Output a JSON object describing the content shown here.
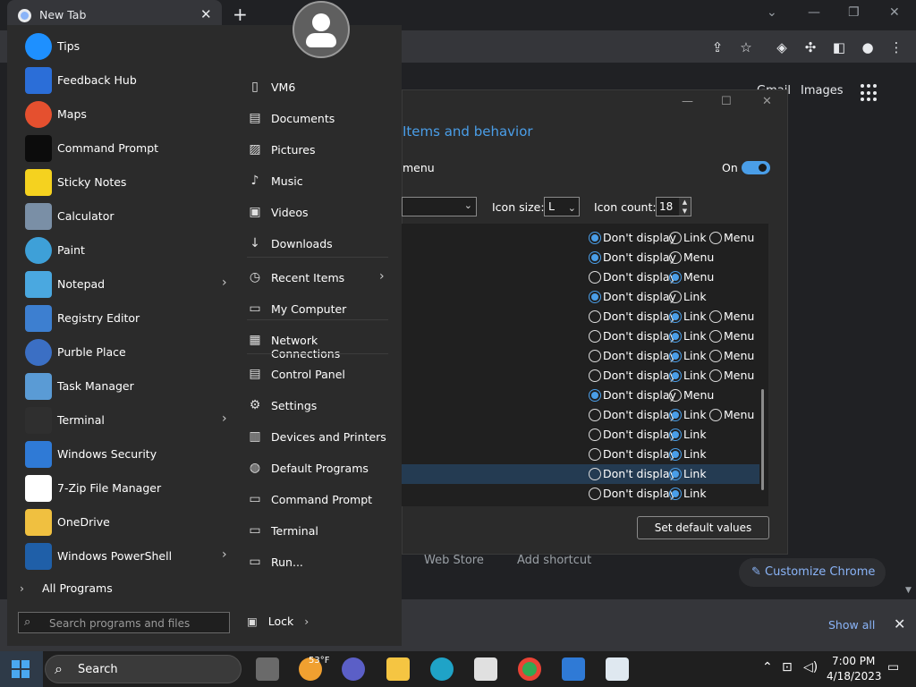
{
  "chrome": {
    "tab_title": "New Tab",
    "tab_close": "✕",
    "new_tab": "+",
    "gmail": "Gmail",
    "images": "Images",
    "shortcuts": [
      "Web Store",
      "Add shortcut"
    ],
    "customize": "Customize Chrome",
    "show_all": "Show all"
  },
  "dialog": {
    "title": "Items and behavior",
    "menu_label": "menu",
    "toggle_label": "On",
    "toggle_on": true,
    "icon_size_label": "Icon size:",
    "icon_size_value": "L",
    "icon_count_label": "Icon count:",
    "icon_count_value": "18",
    "default_button": "Set default values",
    "options_rows": [
      {
        "choices": [
          "Don't display",
          "Link",
          "Menu"
        ],
        "selected": 0,
        "highlight": false
      },
      {
        "choices": [
          "Don't display",
          "Menu"
        ],
        "selected": 0,
        "highlight": false
      },
      {
        "choices": [
          "Don't display",
          "Menu"
        ],
        "selected": 1,
        "highlight": false
      },
      {
        "choices": [
          "Don't display",
          "Link"
        ],
        "selected": 0,
        "highlight": false
      },
      {
        "choices": [
          "Don't display",
          "Link",
          "Menu"
        ],
        "selected": 1,
        "highlight": false
      },
      {
        "choices": [
          "Don't display",
          "Link",
          "Menu"
        ],
        "selected": 1,
        "highlight": false
      },
      {
        "choices": [
          "Don't display",
          "Link",
          "Menu"
        ],
        "selected": 1,
        "highlight": false
      },
      {
        "choices": [
          "Don't display",
          "Link",
          "Menu"
        ],
        "selected": 1,
        "highlight": false
      },
      {
        "choices": [
          "Don't display",
          "Menu"
        ],
        "selected": 0,
        "highlight": false
      },
      {
        "choices": [
          "Don't display",
          "Link",
          "Menu"
        ],
        "selected": 1,
        "highlight": false
      },
      {
        "choices": [
          "Don't display",
          "Link"
        ],
        "selected": 1,
        "highlight": false
      },
      {
        "choices": [
          "Don't display",
          "Link"
        ],
        "selected": 1,
        "highlight": false
      },
      {
        "choices": [
          "Don't display",
          "Link"
        ],
        "selected": 1,
        "highlight": true
      },
      {
        "choices": [
          "Don't display",
          "Link"
        ],
        "selected": 1,
        "highlight": false
      }
    ]
  },
  "start_menu": {
    "programs": [
      {
        "label": "Tips",
        "icon": "tips-icon",
        "color": "#1e90ff",
        "submenu": false
      },
      {
        "label": "Feedback Hub",
        "icon": "feedback-hub-icon",
        "color": "#2b6ed8",
        "submenu": false
      },
      {
        "label": "Maps",
        "icon": "maps-icon",
        "color": "#e5502f",
        "submenu": false
      },
      {
        "label": "Command Prompt",
        "icon": "command-prompt-icon",
        "color": "#0c0c0c",
        "submenu": false
      },
      {
        "label": "Sticky Notes",
        "icon": "sticky-notes-icon",
        "color": "#f5d21f",
        "submenu": false
      },
      {
        "label": "Calculator",
        "icon": "calculator-icon",
        "color": "#7a8fa6",
        "submenu": false
      },
      {
        "label": "Paint",
        "icon": "paint-icon",
        "color": "#3ea0d8",
        "submenu": false
      },
      {
        "label": "Notepad",
        "icon": "notepad-icon",
        "color": "#4aa8e0",
        "submenu": true
      },
      {
        "label": "Registry Editor",
        "icon": "registry-editor-icon",
        "color": "#3d7fd0",
        "submenu": false
      },
      {
        "label": "Purble Place",
        "icon": "purble-place-icon",
        "color": "#3b6fc4",
        "submenu": false
      },
      {
        "label": "Task Manager",
        "icon": "task-manager-icon",
        "color": "#5a9bd5",
        "submenu": false
      },
      {
        "label": "Terminal",
        "icon": "terminal-icon",
        "color": "#2f2f2f",
        "submenu": true
      },
      {
        "label": "Windows Security",
        "icon": "windows-security-icon",
        "color": "#2f7ad6",
        "submenu": false
      },
      {
        "label": "7-Zip File Manager",
        "icon": "7zip-icon",
        "color": "#ffffff",
        "submenu": false
      },
      {
        "label": "OneDrive",
        "icon": "onedrive-icon",
        "color": "#f0c040",
        "submenu": false
      },
      {
        "label": "Windows PowerShell",
        "icon": "powershell-icon",
        "color": "#1f5fa8",
        "submenu": true
      }
    ],
    "all_programs": "All Programs",
    "search_placeholder": "Search programs and files",
    "places": [
      {
        "label": "VM6",
        "icon": "user-folder-icon",
        "glyph": "▯",
        "submenu": false
      },
      {
        "label": "Documents",
        "icon": "documents-icon",
        "glyph": "▤",
        "submenu": false
      },
      {
        "label": "Pictures",
        "icon": "pictures-icon",
        "glyph": "▨",
        "submenu": false
      },
      {
        "label": "Music",
        "icon": "music-icon",
        "glyph": "♪",
        "submenu": false
      },
      {
        "label": "Videos",
        "icon": "videos-icon",
        "glyph": "▣",
        "submenu": false
      },
      {
        "label": "Downloads",
        "icon": "downloads-icon",
        "glyph": "↓",
        "submenu": false
      },
      {
        "label": "Recent Items",
        "icon": "recent-items-icon",
        "glyph": "◷",
        "submenu": true
      },
      {
        "label": "My Computer",
        "icon": "computer-icon",
        "glyph": "▭",
        "submenu": false
      },
      {
        "label": "Network Connections",
        "icon": "network-icon",
        "glyph": "▦",
        "submenu": false
      },
      {
        "label": "Control Panel",
        "icon": "control-panel-icon",
        "glyph": "▤",
        "submenu": false
      },
      {
        "label": "Settings",
        "icon": "settings-icon",
        "glyph": "⚙",
        "submenu": false
      },
      {
        "label": "Devices and Printers",
        "icon": "devices-icon",
        "glyph": "▥",
        "submenu": false
      },
      {
        "label": "Default Programs",
        "icon": "default-programs-icon",
        "glyph": "◍",
        "submenu": false
      },
      {
        "label": "Command Prompt",
        "icon": "command-prompt-icon",
        "glyph": "▭",
        "submenu": false
      },
      {
        "label": "Terminal",
        "icon": "terminal-icon",
        "glyph": "▭",
        "submenu": false
      },
      {
        "label": "Run...",
        "icon": "run-icon",
        "glyph": "▭",
        "submenu": false
      }
    ],
    "lock": "Lock"
  },
  "taskbar": {
    "search": "Search",
    "temperature": "53°F",
    "time": "7:00 PM",
    "date": "4/18/2023"
  }
}
